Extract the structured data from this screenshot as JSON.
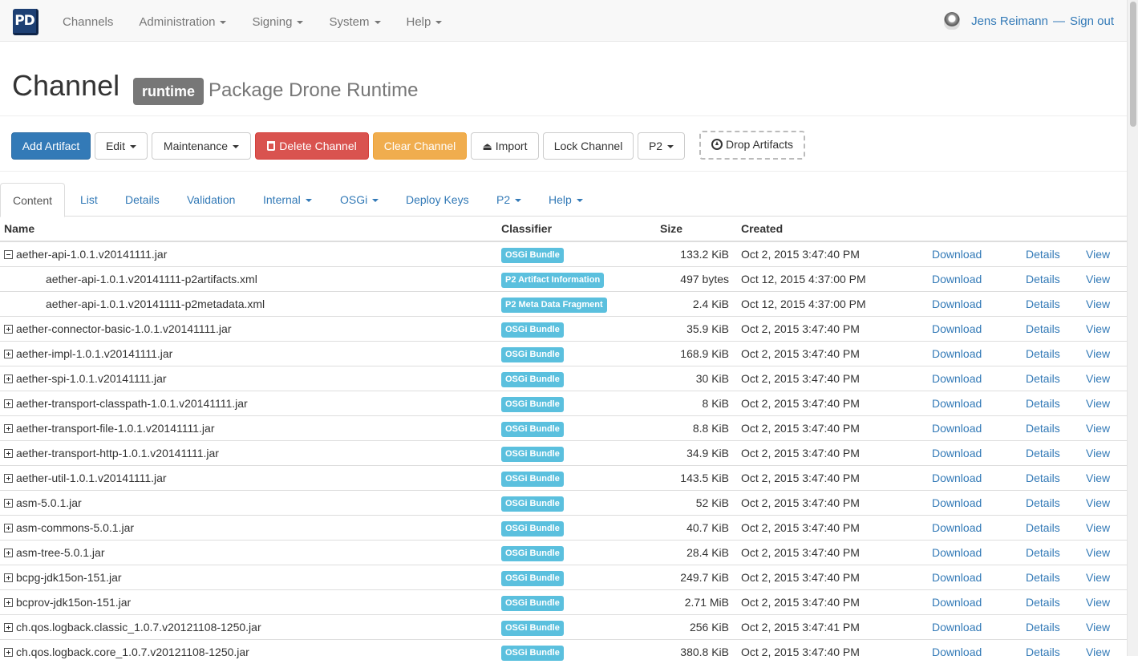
{
  "nav": {
    "brand": "PD",
    "items": [
      {
        "label": "Channels",
        "dropdown": false
      },
      {
        "label": "Administration",
        "dropdown": true
      },
      {
        "label": "Signing",
        "dropdown": true
      },
      {
        "label": "System",
        "dropdown": true
      },
      {
        "label": "Help",
        "dropdown": true
      }
    ],
    "user": "Jens Reimann",
    "separator": "—",
    "signout": "Sign out"
  },
  "header": {
    "title": "Channel",
    "channel_name": "runtime",
    "channel_description": "Package Drone Runtime"
  },
  "toolbar": {
    "add_artifact": "Add Artifact",
    "edit": "Edit",
    "maintenance": "Maintenance",
    "delete_channel": "Delete Channel",
    "clear_channel": "Clear Channel",
    "import": "Import",
    "lock_channel": "Lock Channel",
    "p2": "P2",
    "drop_artifacts": "Drop Artifacts"
  },
  "tabs": [
    {
      "label": "Content",
      "active": true,
      "dropdown": false
    },
    {
      "label": "List",
      "active": false,
      "dropdown": false
    },
    {
      "label": "Details",
      "active": false,
      "dropdown": false
    },
    {
      "label": "Validation",
      "active": false,
      "dropdown": false
    },
    {
      "label": "Internal",
      "active": false,
      "dropdown": true
    },
    {
      "label": "OSGi",
      "active": false,
      "dropdown": true
    },
    {
      "label": "Deploy Keys",
      "active": false,
      "dropdown": false
    },
    {
      "label": "P2",
      "active": false,
      "dropdown": true
    },
    {
      "label": "Help",
      "active": false,
      "dropdown": true
    }
  ],
  "table": {
    "columns": [
      "Name",
      "Classifier",
      "Size",
      "Created"
    ],
    "link_labels": {
      "download": "Download",
      "details": "Details",
      "view": "View"
    },
    "rows": [
      {
        "name": "aether-api-1.0.1.v20141111.jar",
        "toggle": "expanded",
        "classifier": "OSGi Bundle",
        "size": "133.2 KiB",
        "created": "Oct 2, 2015 3:47:40 PM"
      },
      {
        "name": "aether-api-1.0.1.v20141111-p2artifacts.xml",
        "toggle": "child",
        "classifier": "P2 Artifact Information",
        "size": "497 bytes",
        "created": "Oct 12, 2015 4:37:00 PM"
      },
      {
        "name": "aether-api-1.0.1.v20141111-p2metadata.xml",
        "toggle": "child",
        "classifier": "P2 Meta Data Fragment",
        "size": "2.4 KiB",
        "created": "Oct 12, 2015 4:37:00 PM"
      },
      {
        "name": "aether-connector-basic-1.0.1.v20141111.jar",
        "toggle": "collapsed",
        "classifier": "OSGi Bundle",
        "size": "35.9 KiB",
        "created": "Oct 2, 2015 3:47:40 PM"
      },
      {
        "name": "aether-impl-1.0.1.v20141111.jar",
        "toggle": "collapsed",
        "classifier": "OSGi Bundle",
        "size": "168.9 KiB",
        "created": "Oct 2, 2015 3:47:40 PM"
      },
      {
        "name": "aether-spi-1.0.1.v20141111.jar",
        "toggle": "collapsed",
        "classifier": "OSGi Bundle",
        "size": "30 KiB",
        "created": "Oct 2, 2015 3:47:40 PM"
      },
      {
        "name": "aether-transport-classpath-1.0.1.v20141111.jar",
        "toggle": "collapsed",
        "classifier": "OSGi Bundle",
        "size": "8 KiB",
        "created": "Oct 2, 2015 3:47:40 PM"
      },
      {
        "name": "aether-transport-file-1.0.1.v20141111.jar",
        "toggle": "collapsed",
        "classifier": "OSGi Bundle",
        "size": "8.8 KiB",
        "created": "Oct 2, 2015 3:47:40 PM"
      },
      {
        "name": "aether-transport-http-1.0.1.v20141111.jar",
        "toggle": "collapsed",
        "classifier": "OSGi Bundle",
        "size": "34.9 KiB",
        "created": "Oct 2, 2015 3:47:40 PM"
      },
      {
        "name": "aether-util-1.0.1.v20141111.jar",
        "toggle": "collapsed",
        "classifier": "OSGi Bundle",
        "size": "143.5 KiB",
        "created": "Oct 2, 2015 3:47:40 PM"
      },
      {
        "name": "asm-5.0.1.jar",
        "toggle": "collapsed",
        "classifier": "OSGi Bundle",
        "size": "52 KiB",
        "created": "Oct 2, 2015 3:47:40 PM"
      },
      {
        "name": "asm-commons-5.0.1.jar",
        "toggle": "collapsed",
        "classifier": "OSGi Bundle",
        "size": "40.7 KiB",
        "created": "Oct 2, 2015 3:47:40 PM"
      },
      {
        "name": "asm-tree-5.0.1.jar",
        "toggle": "collapsed",
        "classifier": "OSGi Bundle",
        "size": "28.4 KiB",
        "created": "Oct 2, 2015 3:47:40 PM"
      },
      {
        "name": "bcpg-jdk15on-151.jar",
        "toggle": "collapsed",
        "classifier": "OSGi Bundle",
        "size": "249.7 KiB",
        "created": "Oct 2, 2015 3:47:40 PM"
      },
      {
        "name": "bcprov-jdk15on-151.jar",
        "toggle": "collapsed",
        "classifier": "OSGi Bundle",
        "size": "2.71 MiB",
        "created": "Oct 2, 2015 3:47:40 PM"
      },
      {
        "name": "ch.qos.logback.classic_1.0.7.v20121108-1250.jar",
        "toggle": "collapsed",
        "classifier": "OSGi Bundle",
        "size": "256 KiB",
        "created": "Oct 2, 2015 3:47:41 PM"
      },
      {
        "name": "ch.qos.logback.core_1.0.7.v20121108-1250.jar",
        "toggle": "collapsed",
        "classifier": "OSGi Bundle",
        "size": "380.8 KiB",
        "created": "Oct 2, 2015 3:47:40 PM"
      }
    ]
  },
  "colors": {
    "primary": "#337ab7",
    "danger": "#d9534f",
    "warning": "#f0ad4e",
    "info_badge": "#5bc0de",
    "label_default": "#777777"
  }
}
